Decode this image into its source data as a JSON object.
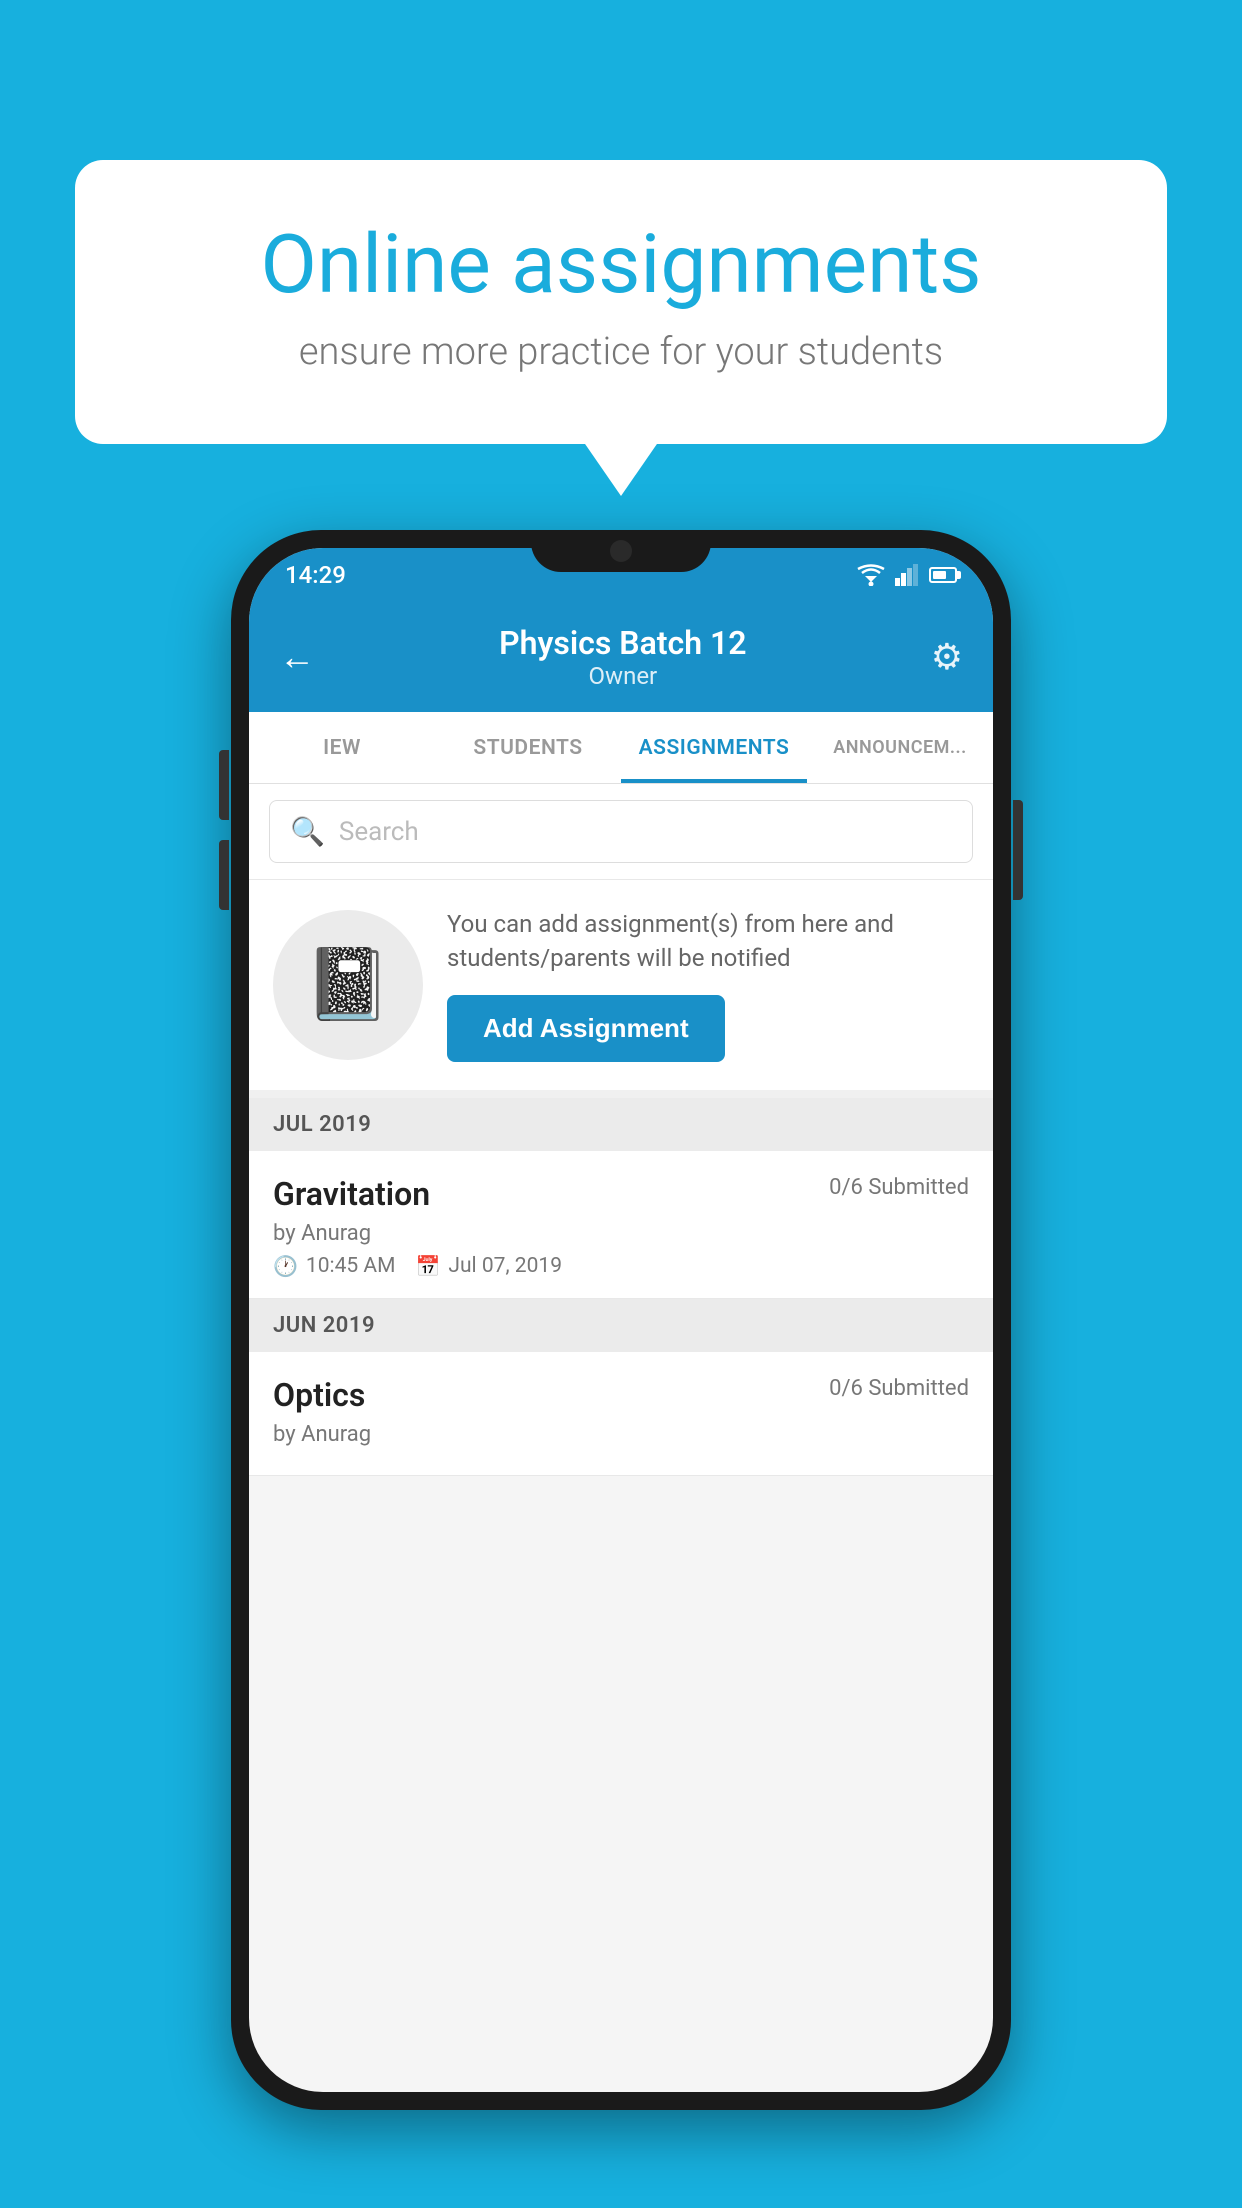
{
  "background_color": "#17b0de",
  "speech_bubble": {
    "title": "Online assignments",
    "subtitle": "ensure more practice for your students"
  },
  "status_bar": {
    "time": "14:29"
  },
  "header": {
    "title": "Physics Batch 12",
    "subtitle": "Owner",
    "back_label": "←",
    "settings_label": "⚙"
  },
  "tabs": [
    {
      "label": "IEW",
      "active": false
    },
    {
      "label": "STUDENTS",
      "active": false
    },
    {
      "label": "ASSIGNMENTS",
      "active": true
    },
    {
      "label": "ANNOUNCEM...",
      "active": false
    }
  ],
  "search": {
    "placeholder": "Search"
  },
  "promo": {
    "text": "You can add assignment(s) from here and students/parents will be notified",
    "button_label": "Add Assignment"
  },
  "sections": [
    {
      "month_label": "JUL 2019",
      "assignments": [
        {
          "name": "Gravitation",
          "status": "0/6 Submitted",
          "by": "by Anurag",
          "time": "10:45 AM",
          "date": "Jul 07, 2019"
        }
      ]
    },
    {
      "month_label": "JUN 2019",
      "assignments": [
        {
          "name": "Optics",
          "status": "0/6 Submitted",
          "by": "by Anurag",
          "time": "",
          "date": ""
        }
      ]
    }
  ]
}
